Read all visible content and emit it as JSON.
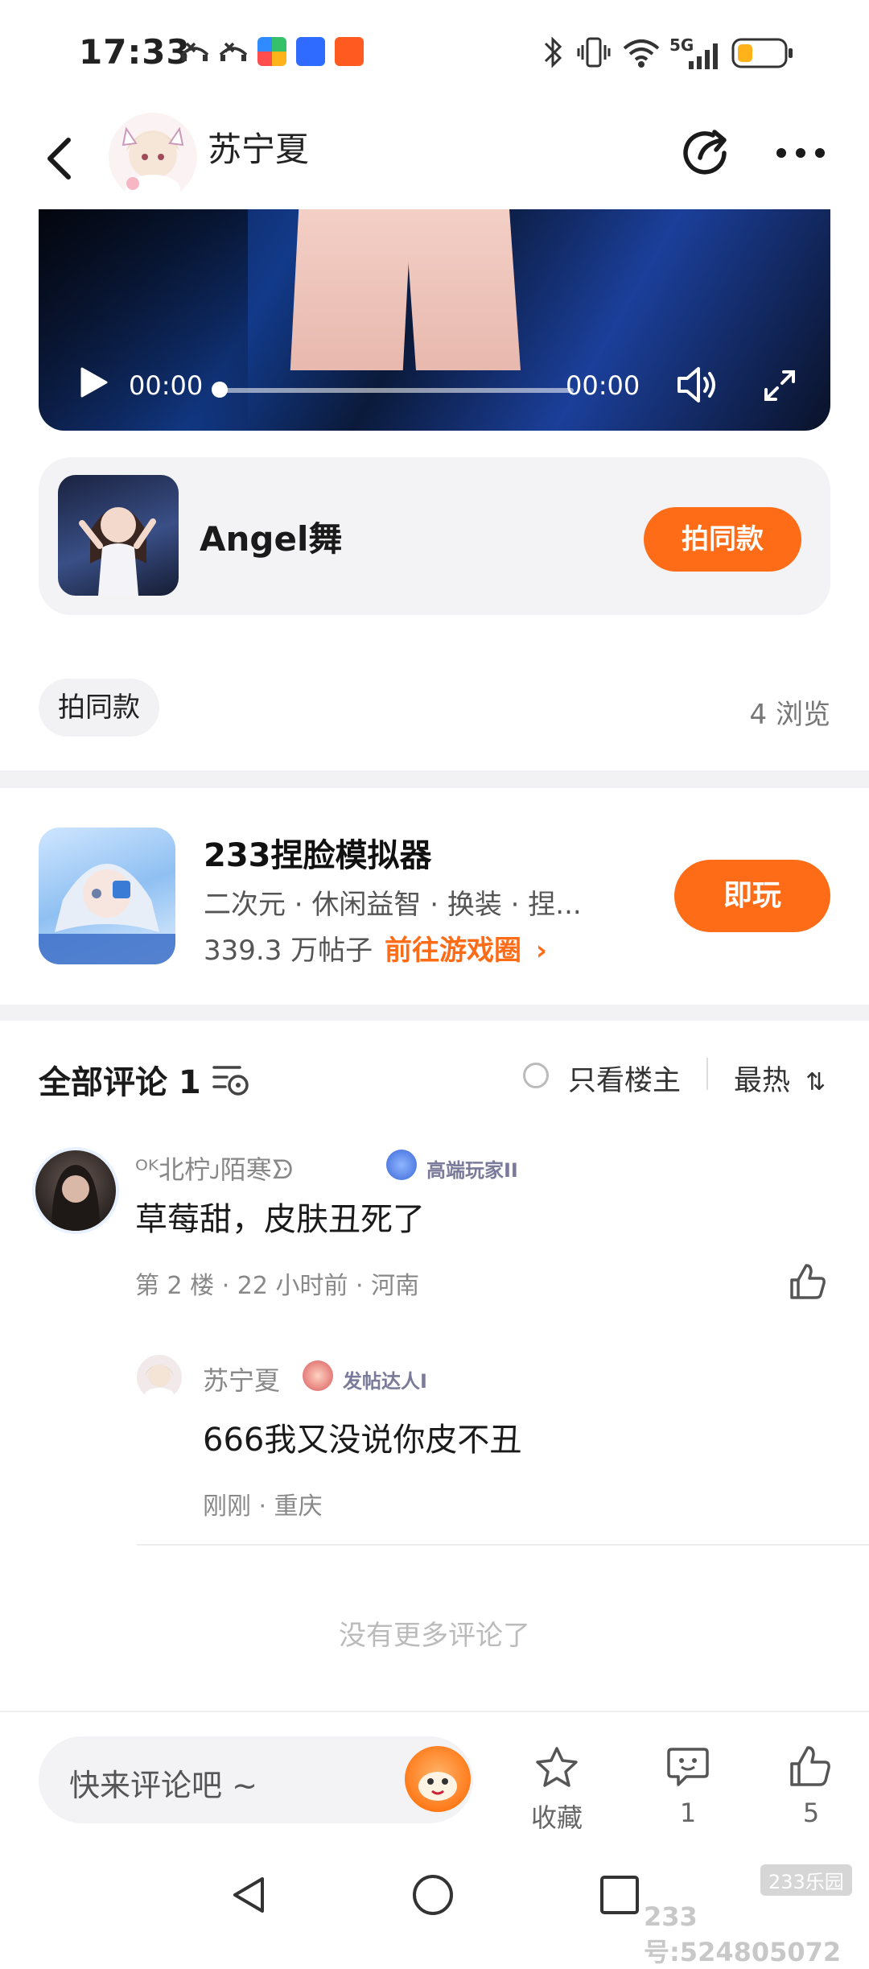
{
  "status_bar": {
    "time": "17:33",
    "network": "5G",
    "notification_icons": [
      "missed-call-icon",
      "missed-call-icon",
      "colorful-app-icon",
      "baidu-icon",
      "taobao-icon"
    ]
  },
  "header": {
    "author_name": "苏宁夏"
  },
  "video": {
    "current_time": "00:00",
    "duration": "00:00"
  },
  "game_card": {
    "title": "Angel舞",
    "button_label": "拍同款"
  },
  "post": {
    "tag": "拍同款",
    "views": "4 浏览"
  },
  "game_promo": {
    "title": "233捏脸模拟器",
    "tags": "二次元 · 休闲益智 · 换装 · 捏...",
    "posts": "339.3 万帖子",
    "link_label": "前往游戏圈",
    "button_label": "即玩"
  },
  "comments": {
    "title": "全部评论 1",
    "only_host_label": "只看楼主",
    "sort_label": "最热",
    "items": [
      {
        "user": "ᴼᴷ北柠ᴊ陌寒ᗦ",
        "badge": "高端玩家II",
        "text": "草莓甜，皮肤丑死了",
        "meta": "第 2 楼 · 22 小时前 · 河南",
        "reply": {
          "user": "苏宁夏",
          "badge": "发帖达人I",
          "text": "666我又没说你皮不丑",
          "meta": "刚刚 · 重庆"
        }
      }
    ],
    "no_more": "没有更多评论了"
  },
  "bottom_bar": {
    "input_placeholder": "快来评论吧 ~",
    "favorite_label": "收藏",
    "comment_count": "1",
    "like_count": "5"
  },
  "watermark": {
    "logo": "233乐园",
    "text": "233号:524805072"
  },
  "colors": {
    "accent": "#ff6c17",
    "background": "#ffffff",
    "divider": "#f2f2f5"
  }
}
